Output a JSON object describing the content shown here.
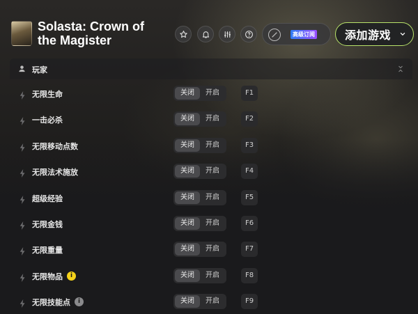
{
  "header": {
    "game_title": "Solasta: Crown of the Magister",
    "pro_badge": "高级订阅",
    "add_game_label": "添加游戏"
  },
  "section": {
    "title": "玩家"
  },
  "cheats": [
    {
      "name": "无限生命",
      "off": "关闭",
      "on": "开启",
      "hotkey": "F1",
      "state": "off"
    },
    {
      "name": "一击必杀",
      "off": "关闭",
      "on": "开启",
      "hotkey": "F2",
      "state": "off"
    },
    {
      "name": "无限移动点数",
      "off": "关闭",
      "on": "开启",
      "hotkey": "F3",
      "state": "off"
    },
    {
      "name": "无限法术施放",
      "off": "关闭",
      "on": "开启",
      "hotkey": "F4",
      "state": "off"
    },
    {
      "name": "超级经验",
      "off": "关闭",
      "on": "开启",
      "hotkey": "F5",
      "state": "off"
    },
    {
      "name": "无限金钱",
      "off": "关闭",
      "on": "开启",
      "hotkey": "F6",
      "state": "off"
    },
    {
      "name": "无限重量",
      "off": "关闭",
      "on": "开启",
      "hotkey": "F7",
      "state": "off"
    },
    {
      "name": "无限物品",
      "off": "关闭",
      "on": "开启",
      "hotkey": "F8",
      "state": "off",
      "info": "i",
      "info_style": "warning"
    },
    {
      "name": "无限技能点",
      "off": "关闭",
      "on": "开启",
      "hotkey": "F9",
      "state": "off",
      "info": "i",
      "info_style": "neutral"
    }
  ],
  "colors": {
    "accent": "#b9e46a",
    "warning": "#f5d21a",
    "info_neutral": "#8a8a8c"
  },
  "icons": [
    "star-icon",
    "bell-icon",
    "sliders-icon",
    "help-icon",
    "pro-icon",
    "chevron-down-icon",
    "user-icon",
    "collapse-icon",
    "bolt-icon"
  ]
}
